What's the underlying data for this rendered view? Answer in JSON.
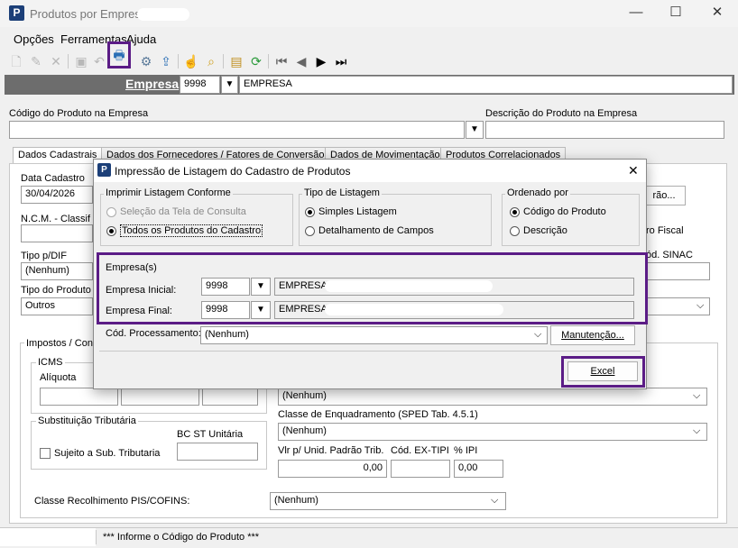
{
  "window": {
    "title": "Produtos por Empresa",
    "controls": {
      "minimize": "—",
      "maximize": "☐",
      "close": "✕"
    }
  },
  "menu": {
    "items": [
      "Opções",
      "Ferramentas",
      "Ajuda"
    ]
  },
  "toolbar": {
    "icons": [
      "new-icon",
      "edit-icon",
      "delete-icon",
      "save-icon",
      "undo-icon",
      "print-icon",
      "print-setup-icon",
      "export-icon",
      "hand-icon",
      "search-icon",
      "properties-icon",
      "refresh-icon",
      "first-record-icon",
      "previous-record-icon",
      "next-record-icon",
      "last-record-icon"
    ]
  },
  "empresa_bar": {
    "label": "Empresa",
    "code": "9998",
    "name": "EMPRESA"
  },
  "product_header": {
    "code_label": "Código do Produto na Empresa",
    "code_value": "",
    "desc_label": "Descrição do Produto na Empresa",
    "desc_value": ""
  },
  "tabs": [
    "Dados Cadastrais",
    "Dados dos Fornecedores / Fatores de Conversão",
    "Dados de Movimentação",
    "Produtos Correlacionados"
  ],
  "dados_cadastrais": {
    "data_cadastro_label": "Data Cadastro",
    "data_cadastro_value": "30/04/2026",
    "ncm_label": "N.C.M. - Classif",
    "tipo_pdif_label": "Tipo p/DIF",
    "tipo_pdif_value": "(Nenhum)",
    "tipo_produto_label": "Tipo do Produto",
    "tipo_produto_value": "Outros",
    "partial_button": "rão...",
    "partial_fiscal": "ro Fiscal",
    "partial_sinac": "ód. SINAC",
    "impostos_label": "Impostos / Con",
    "icms_label": "ICMS",
    "aliquota_label": "Alíquota",
    "subst_label": "Substituição Tributária",
    "bc_st_label": "BC ST Unitária",
    "sujeito_label": "Sujeito a Sub. Tributaria",
    "right_select_1": "(Nenhum)",
    "classe_enq_label": "Classe de Enquadramento (SPED Tab. 4.5.1)",
    "classe_enq_value": "(Nenhum)",
    "vlr_label": "Vlr p/ Unid. Padrão Trib.",
    "vlr_value": "0,00",
    "ex_tipi_label": "Cód. EX-TIPI",
    "ex_tipi_value": "",
    "ipi_label": "% IPI",
    "ipi_value": "0,00",
    "pis_label": "Classe Recolhimento PIS/COFINS:",
    "pis_value": "(Nenhum)"
  },
  "dialog": {
    "title": "Impressão de Listagem do Cadastro de Produtos",
    "imprimir": {
      "title": "Imprimir Listagem Conforme",
      "options": [
        "Seleção da Tela de Consulta",
        "Todos os Produtos do Cadastro"
      ],
      "selected": "Todos os Produtos do Cadastro"
    },
    "tipo": {
      "title": "Tipo de Listagem",
      "options": [
        "Simples Listagem",
        "Detalhamento de Campos"
      ],
      "selected": "Simples Listagem"
    },
    "ordenado": {
      "title": "Ordenado por",
      "options": [
        "Código do Produto",
        "Descrição"
      ],
      "selected": "Código do Produto"
    },
    "empresas": {
      "title": "Empresa(s)",
      "inicial_label": "Empresa Inicial:",
      "inicial_code": "9998",
      "inicial_name": "EMPRESA",
      "final_label": "Empresa Final:",
      "final_code": "9998",
      "final_name": "EMPRESA"
    },
    "processamento_label": "Cód. Processamento:",
    "processamento_value": "(Nenhum)",
    "manutencao_button": "Manutenção...",
    "excel_button": "Excel"
  },
  "status": {
    "message": "*** Informe o Código do Produto ***"
  },
  "colors": {
    "highlight": "#5b1c86",
    "empresa_bar": "#6d6d6d",
    "logo": "#1c3f78"
  }
}
